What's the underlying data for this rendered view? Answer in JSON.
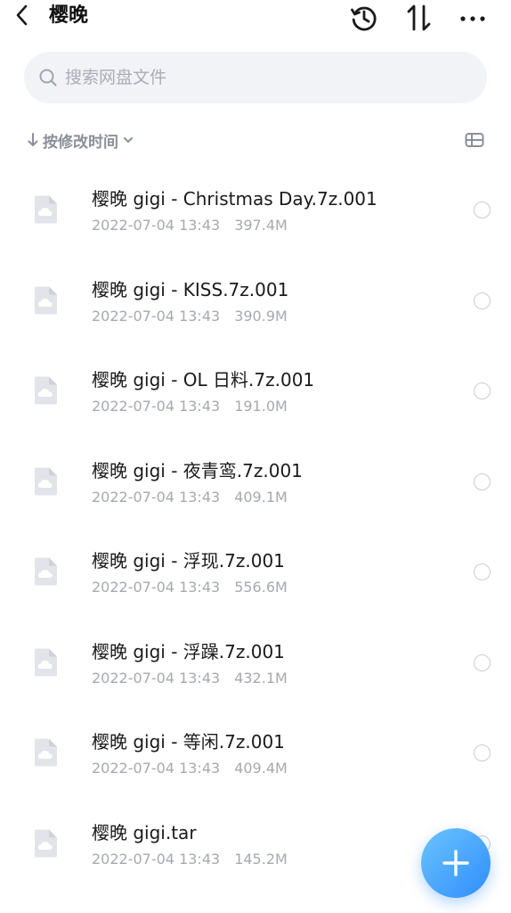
{
  "header": {
    "title": "樱晚",
    "icons": [
      "chevron-left-icon",
      "history-icon",
      "sort-icon",
      "more-icon"
    ]
  },
  "search": {
    "placeholder": "搜索网盘文件",
    "value": ""
  },
  "sort": {
    "label": "按修改时间"
  },
  "files": [
    {
      "name": "樱晚 gigi - Christmas Day.7z.001",
      "date": "2022-07-04 13:43",
      "size": "397.4M"
    },
    {
      "name": "樱晚 gigi - KISS.7z.001",
      "date": "2022-07-04 13:43",
      "size": "390.9M"
    },
    {
      "name": "樱晚 gigi - OL 日料.7z.001",
      "date": "2022-07-04 13:43",
      "size": "191.0M"
    },
    {
      "name": "樱晚 gigi - 夜青鸾.7z.001",
      "date": "2022-07-04 13:43",
      "size": "409.1M"
    },
    {
      "name": "樱晚 gigi - 浮现.7z.001",
      "date": "2022-07-04 13:43",
      "size": "556.6M"
    },
    {
      "name": "樱晚 gigi - 浮躁.7z.001",
      "date": "2022-07-04 13:43",
      "size": "432.1M"
    },
    {
      "name": "樱晚 gigi - 等闲.7z.001",
      "date": "2022-07-04 13:43",
      "size": "409.4M"
    },
    {
      "name": "樱晚 gigi.tar",
      "date": "2022-07-04 13:43",
      "size": "145.2M"
    }
  ],
  "colors": {
    "accent": "#2f8dfb",
    "fab_light": "#6cc4ff",
    "muted_text": "#a6a9b0"
  }
}
